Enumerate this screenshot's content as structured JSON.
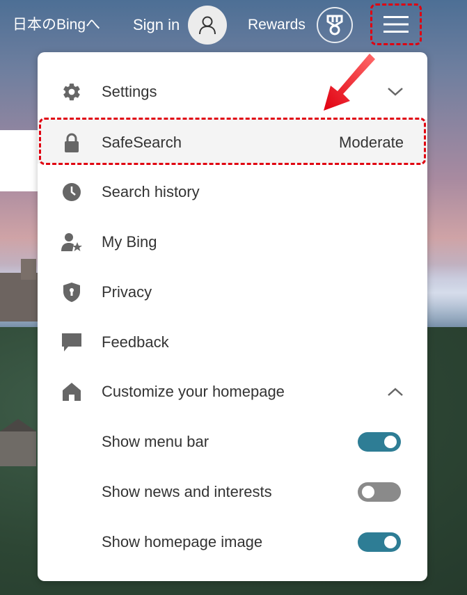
{
  "header": {
    "lang_link": "日本のBingへ",
    "signin_label": "Sign in",
    "rewards_label": "Rewards"
  },
  "icons": {
    "avatar": "person-outline-icon",
    "rewards": "medal-icon",
    "menu": "hamburger-menu-icon"
  },
  "menu": {
    "settings": {
      "label": "Settings",
      "icon": "gear-icon"
    },
    "safesearch": {
      "label": "SafeSearch",
      "value": "Moderate",
      "icon": "lock-icon"
    },
    "search_history": {
      "label": "Search history",
      "icon": "clock-icon"
    },
    "my_bing": {
      "label": "My Bing",
      "icon": "user-star-icon"
    },
    "privacy": {
      "label": "Privacy",
      "icon": "shield-lock-icon"
    },
    "feedback": {
      "label": "Feedback",
      "icon": "chat-bubble-icon"
    },
    "customize": {
      "label": "Customize your homepage",
      "icon": "home-icon"
    },
    "toggles": [
      {
        "label": "Show menu bar",
        "on": true
      },
      {
        "label": "Show news and interests",
        "on": false
      },
      {
        "label": "Show homepage image",
        "on": true
      }
    ]
  },
  "colors": {
    "toggle_on": "#2e7d95",
    "toggle_off": "#8a8a8a",
    "annotation_red": "#e00010"
  }
}
